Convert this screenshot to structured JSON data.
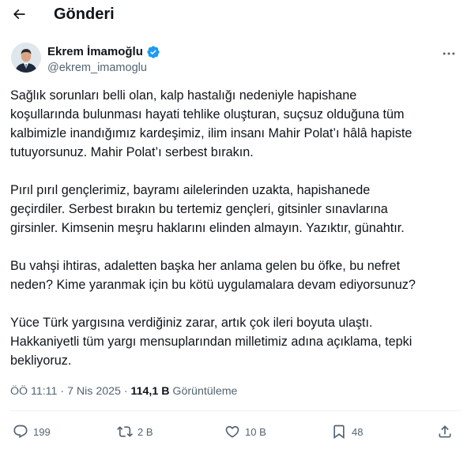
{
  "header": {
    "title": "Gönderi"
  },
  "author": {
    "name": "Ekrem İmamoğlu",
    "handle": "@ekrem_imamoglu",
    "verified": true
  },
  "post": {
    "paragraphs": [
      "Sağlık sorunları belli olan, kalp hastalığı nedeniyle hapishane\nkoşullarında bulunması hayati tehlike oluşturan, suçsuz olduğuna tüm\nkalbimizle inandığımız kardeşimiz, ilim insanı Mahir Polat’ı hâlâ hapiste\ntutuyorsunuz. Mahir Polat’ı serbest bırakın.",
      "Pırıl pırıl gençlerimiz, bayramı ailelerinden uzakta, hapishanede\ngeçirdiler. Serbest bırakın bu tertemiz gençleri, gitsinler sınavlarına\ngirsinler. Kimsenin meşru haklarını elinden almayın. Yazıktır, günahtır.",
      "Bu vahşi ihtiras, adaletten başka her anlama gelen bu öfke, bu nefret\nneden? Kime yaranmak için bu kötü uygulamalara devam ediyorsunuz?",
      "Yüce Türk yargısına verdiğiniz zarar, artık çok ileri boyuta ulaştı.\nHakkaniyetli tüm yargı mensuplarından milletimiz adına açıklama, tepki\nbekliyoruz."
    ]
  },
  "meta": {
    "time": "ÖÖ 11:11",
    "separator": "·",
    "date": "7 Nis 2025",
    "views_count": "114,1 B",
    "views_label": "Görüntüleme"
  },
  "actions": {
    "replies": "199",
    "reposts": "2 B",
    "likes": "10 B",
    "bookmarks": "48"
  },
  "icons": {
    "back": "arrow-left-icon",
    "more": "more-horizontal-icon",
    "verified": "verified-badge-icon",
    "reply": "reply-icon",
    "repost": "repost-icon",
    "like": "heart-icon",
    "bookmark": "bookmark-icon",
    "share": "share-icon"
  },
  "colors": {
    "text": "#0f1419",
    "secondary": "#536471",
    "verified": "#1d9bf0",
    "divider": "#eff3f4"
  }
}
